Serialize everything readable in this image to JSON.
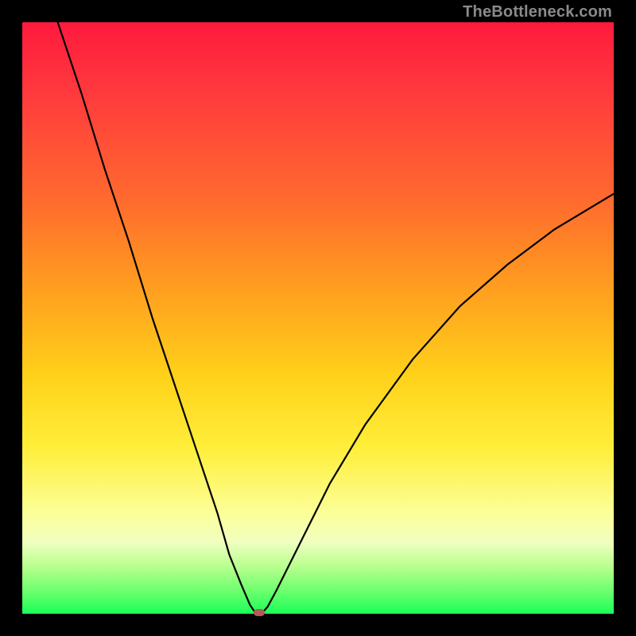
{
  "attribution": "TheBottleneck.com",
  "chart_data": {
    "type": "line",
    "title": "",
    "xlabel": "",
    "ylabel": "",
    "xlim": [
      0,
      100
    ],
    "ylim": [
      0,
      100
    ],
    "x": [
      6,
      10,
      14,
      18,
      22,
      26,
      30,
      33,
      35,
      37,
      38.5,
      39.3,
      40,
      40.7,
      41.5,
      43,
      47,
      52,
      58,
      66,
      74,
      82,
      90,
      100
    ],
    "values": [
      100,
      88,
      75,
      63,
      50,
      38,
      26,
      17,
      10,
      5,
      1.5,
      0.3,
      0,
      0.3,
      1.2,
      4,
      12,
      22,
      32,
      43,
      52,
      59,
      65,
      71
    ],
    "grid": false,
    "legend": false,
    "marker": {
      "x": 40,
      "y": 0
    }
  },
  "colors": {
    "curve": "#000000",
    "marker": "#b35b52",
    "gradient_top": "#ff1a3d",
    "gradient_bottom": "#1aff58",
    "frame": "#000000"
  }
}
